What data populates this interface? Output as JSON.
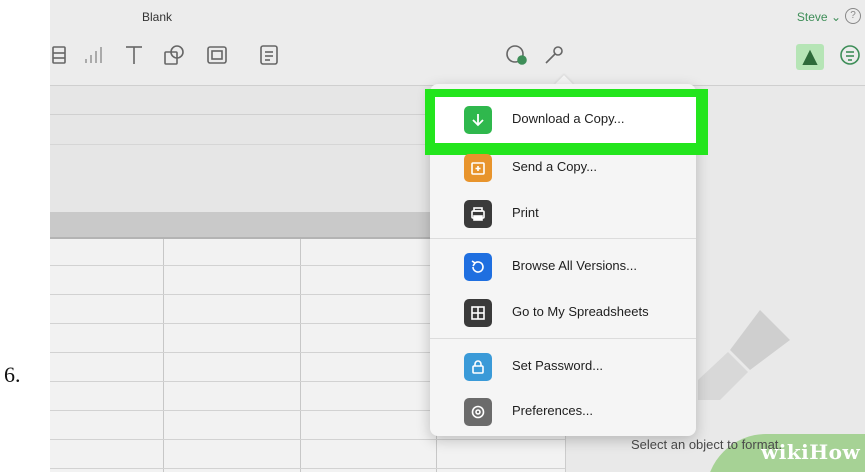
{
  "step": {
    "number": "6."
  },
  "window": {
    "title": "Blank"
  },
  "user": {
    "name": "Steve ⌄",
    "help": "?"
  },
  "toolbar": {
    "icons": [
      "table-icon",
      "chart-icon",
      "text-icon",
      "shape-icon",
      "media-icon",
      "comment-icon",
      "collaborate-icon",
      "settings-wrench-icon",
      "format-brush-icon",
      "organize-icon"
    ]
  },
  "menu": {
    "items": [
      {
        "label": "Download a Copy...",
        "icon": "download-arrow-icon",
        "color": "#2fb84d",
        "highlighted": true
      },
      {
        "label": "Send a Copy...",
        "icon": "send-copy-icon",
        "color": "#e8942c"
      },
      {
        "label": "Print",
        "icon": "printer-icon",
        "color": "#3a3a3a"
      },
      {
        "label": "Browse All Versions...",
        "icon": "versions-icon",
        "color": "#1f6fe0"
      },
      {
        "label": "Go to My Spreadsheets",
        "icon": "spreadsheets-grid-icon",
        "color": "#3a3a3a"
      },
      {
        "label": "Set Password...",
        "icon": "lock-icon",
        "color": "#3a9ad8"
      },
      {
        "label": "Preferences...",
        "icon": "gear-icon",
        "color": "#6b6b6b"
      }
    ]
  },
  "inspector": {
    "hint": "Select an object to format."
  },
  "watermark": {
    "text": "wikiHow"
  },
  "colors": {
    "highlight": "#23e51d",
    "accent_green": "#3e8e58"
  }
}
